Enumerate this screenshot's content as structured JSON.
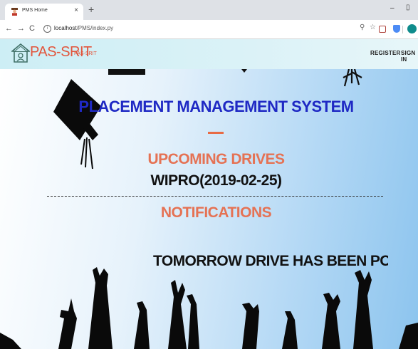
{
  "browser": {
    "tab_title": "PMS Home",
    "tab_close": "×",
    "new_tab": "+",
    "url_host": "localhost",
    "url_path": "/PMS/index.py",
    "minimize": "–",
    "restore": "▯"
  },
  "site": {
    "brand": "PAS-SRIT",
    "brand_small": "PAS-SRIT",
    "nav": {
      "register": "REGISTER",
      "signin": "SIGN IN"
    },
    "hero": {
      "title": "PLACEMENT MANAGEMENT SYSTEM",
      "drives_heading": "UPCOMING DRIVES",
      "drives": [
        "WIPRO(2019-02-25)"
      ],
      "notifications_heading": "NOTIFICATIONS",
      "notification_text": "TOMORROW DRIVE HAS BEEN POSTPONED"
    }
  },
  "colors": {
    "brand": "#e2553c",
    "title": "#1f29c4",
    "heading": "#e57254",
    "navbar": "#d8f1f7"
  }
}
